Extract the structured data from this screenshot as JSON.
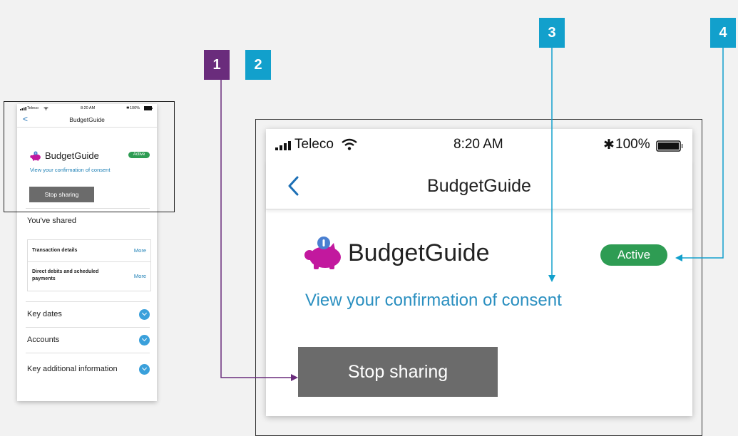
{
  "status_bar": {
    "carrier": "Teleco",
    "time": "8:20 AM",
    "battery": "100%"
  },
  "nav": {
    "back_glyph": "<",
    "title": "BudgetGuide"
  },
  "app": {
    "name": "BudgetGuide",
    "status_badge": "Active",
    "consent_link": "View your confirmation of consent"
  },
  "actions": {
    "stop_sharing": "Stop sharing"
  },
  "shared": {
    "heading": "You've shared",
    "items": [
      {
        "label": "Transaction details",
        "action": "More"
      },
      {
        "label": "Direct debits and scheduled payments",
        "action": "More"
      }
    ]
  },
  "sections": [
    {
      "label": "Key dates"
    },
    {
      "label": "Accounts"
    },
    {
      "label": "Key additional information"
    }
  ],
  "callouts": [
    "1",
    "2",
    "3",
    "4"
  ],
  "colors": {
    "callout_purple": "#6a2c7c",
    "callout_blue": "#12a0cc",
    "active_green": "#2e9c53",
    "link_blue": "#2a8fc0",
    "button_gray": "#6b6b6b",
    "chevron_blue": "#3aa0db",
    "piggy_magenta": "#c2189e"
  },
  "icons": {
    "signal": "signal-bars-icon",
    "wifi": "wifi-icon",
    "bluetooth": "bluetooth-icon",
    "battery": "battery-icon",
    "back": "chevron-left-icon",
    "app_logo": "piggy-bank-icon",
    "expand": "chevron-down-circle-icon"
  }
}
